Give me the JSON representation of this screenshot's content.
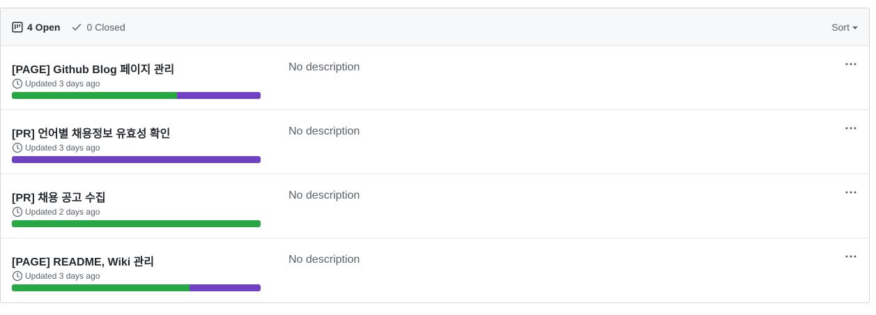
{
  "header": {
    "open_label": "4 Open",
    "closed_label": "0 Closed",
    "sort_label": "Sort"
  },
  "colors": {
    "done": "#28a745",
    "in_progress": "#6f42c1",
    "border": "#d1d5da",
    "header_bg": "#f6f8fa"
  },
  "projects": [
    {
      "title": "[PAGE] Github Blog 페이지 관리",
      "updated": "Updated 3 days ago",
      "description": "No description",
      "progress": {
        "done_pct": 66.5,
        "in_progress_pct": 33.5
      },
      "menu_icon": "kebab-horizontal-icon"
    },
    {
      "title": "[PR] 언어별 채용정보 유효성 확인",
      "updated": "Updated 3 days ago",
      "description": "No description",
      "progress": {
        "done_pct": 0,
        "in_progress_pct": 100
      },
      "menu_icon": "kebab-horizontal-icon"
    },
    {
      "title": "[PR] 채용 공고 수집",
      "updated": "Updated 2 days ago",
      "description": "No description",
      "progress": {
        "done_pct": 100,
        "in_progress_pct": 0
      },
      "menu_icon": "kebab-horizontal-icon"
    },
    {
      "title": "[PAGE] README, Wiki 관리",
      "updated": "Updated 3 days ago",
      "description": "No description",
      "progress": {
        "done_pct": 71.5,
        "in_progress_pct": 28.5
      },
      "menu_icon": "kebab-horizontal-icon"
    }
  ]
}
